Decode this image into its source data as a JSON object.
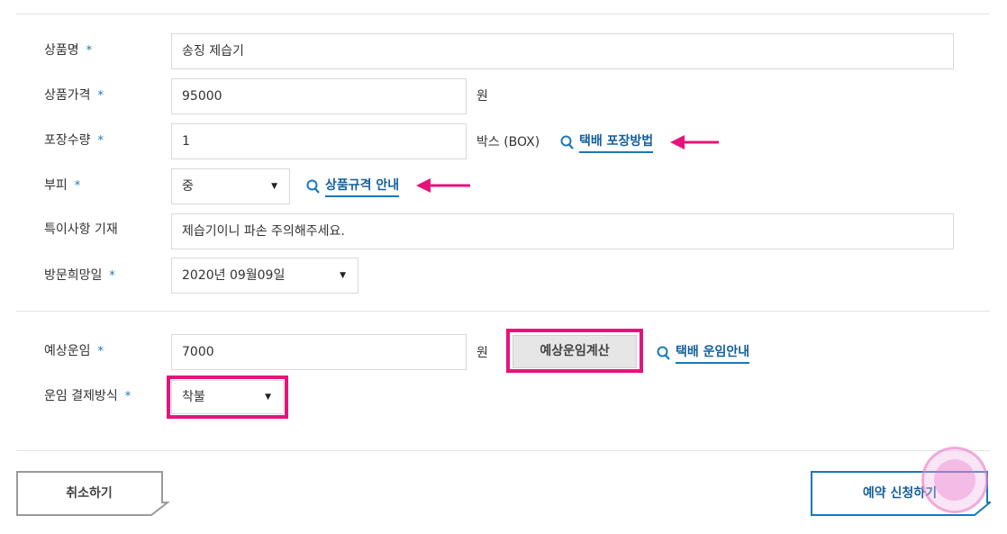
{
  "form": {
    "product_name": {
      "label": "상품명",
      "value": "송징 제습기"
    },
    "product_price": {
      "label": "상품가격",
      "value": "95000",
      "unit": "원"
    },
    "package_qty": {
      "label": "포장수량",
      "value": "1",
      "unit": "박스 (BOX)",
      "guide": "택배 포장방법"
    },
    "volume": {
      "label": "부피",
      "value": "중",
      "guide": "상품규격 안내"
    },
    "notes": {
      "label": "특이사항 기재",
      "value": "제습기이니 파손 주의해주세요."
    },
    "visit_date": {
      "label": "방문희망일",
      "value": "2020년 09월09일"
    },
    "estimated_fee": {
      "label": "예상운임",
      "value": "7000",
      "unit": "원",
      "calc_button": "예상운임계산",
      "guide": "택배 운임안내"
    },
    "payment_method": {
      "label": "운임 결제방식",
      "value": "착불"
    },
    "required_mark": "*"
  },
  "buttons": {
    "cancel": "취소하기",
    "submit": "예약 신청하기"
  },
  "colors": {
    "accent": "#1a78b7",
    "highlight": "#e6147a"
  }
}
